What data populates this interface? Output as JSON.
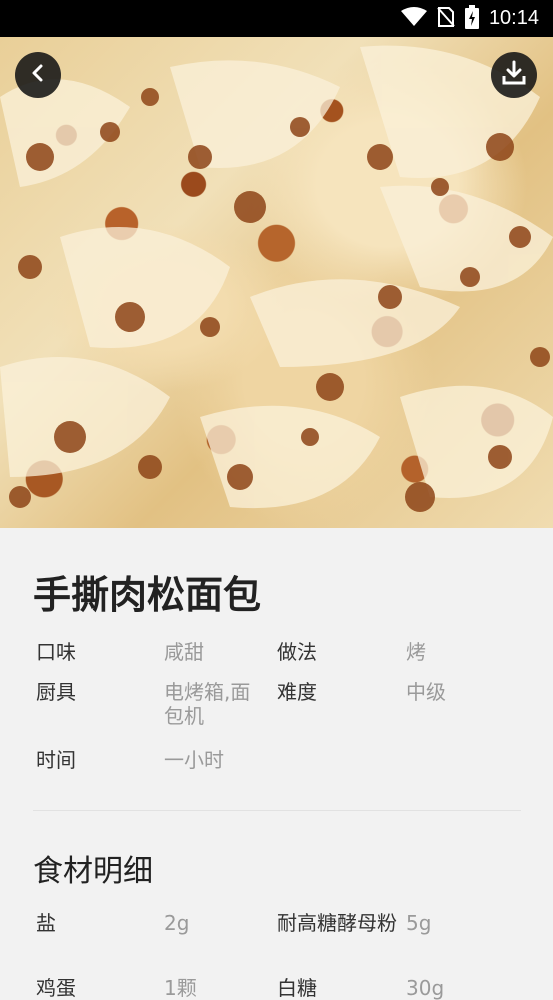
{
  "status_bar": {
    "time": "10:14",
    "icons": [
      "wifi-icon",
      "no-sim-icon",
      "battery-charging-icon"
    ]
  },
  "hero": {
    "back_icon": "chevron-left-icon",
    "download_icon": "download-icon"
  },
  "recipe": {
    "title": "手撕肉松面包",
    "info": [
      {
        "label": "口味",
        "value": "咸甜"
      },
      {
        "label": "做法",
        "value": "烤"
      },
      {
        "label": "厨具",
        "value": "电烤箱,面包机"
      },
      {
        "label": "难度",
        "value": "中级"
      },
      {
        "label": "时间",
        "value": "一小时"
      }
    ]
  },
  "ingredients": {
    "title": "食材明细",
    "items": [
      {
        "name": "盐",
        "amount": "2g"
      },
      {
        "name": "耐高糖酵母粉",
        "amount": "5g"
      },
      {
        "name": "鸡蛋",
        "amount": "1颗"
      },
      {
        "name": "白糖",
        "amount": "30g"
      }
    ]
  }
}
